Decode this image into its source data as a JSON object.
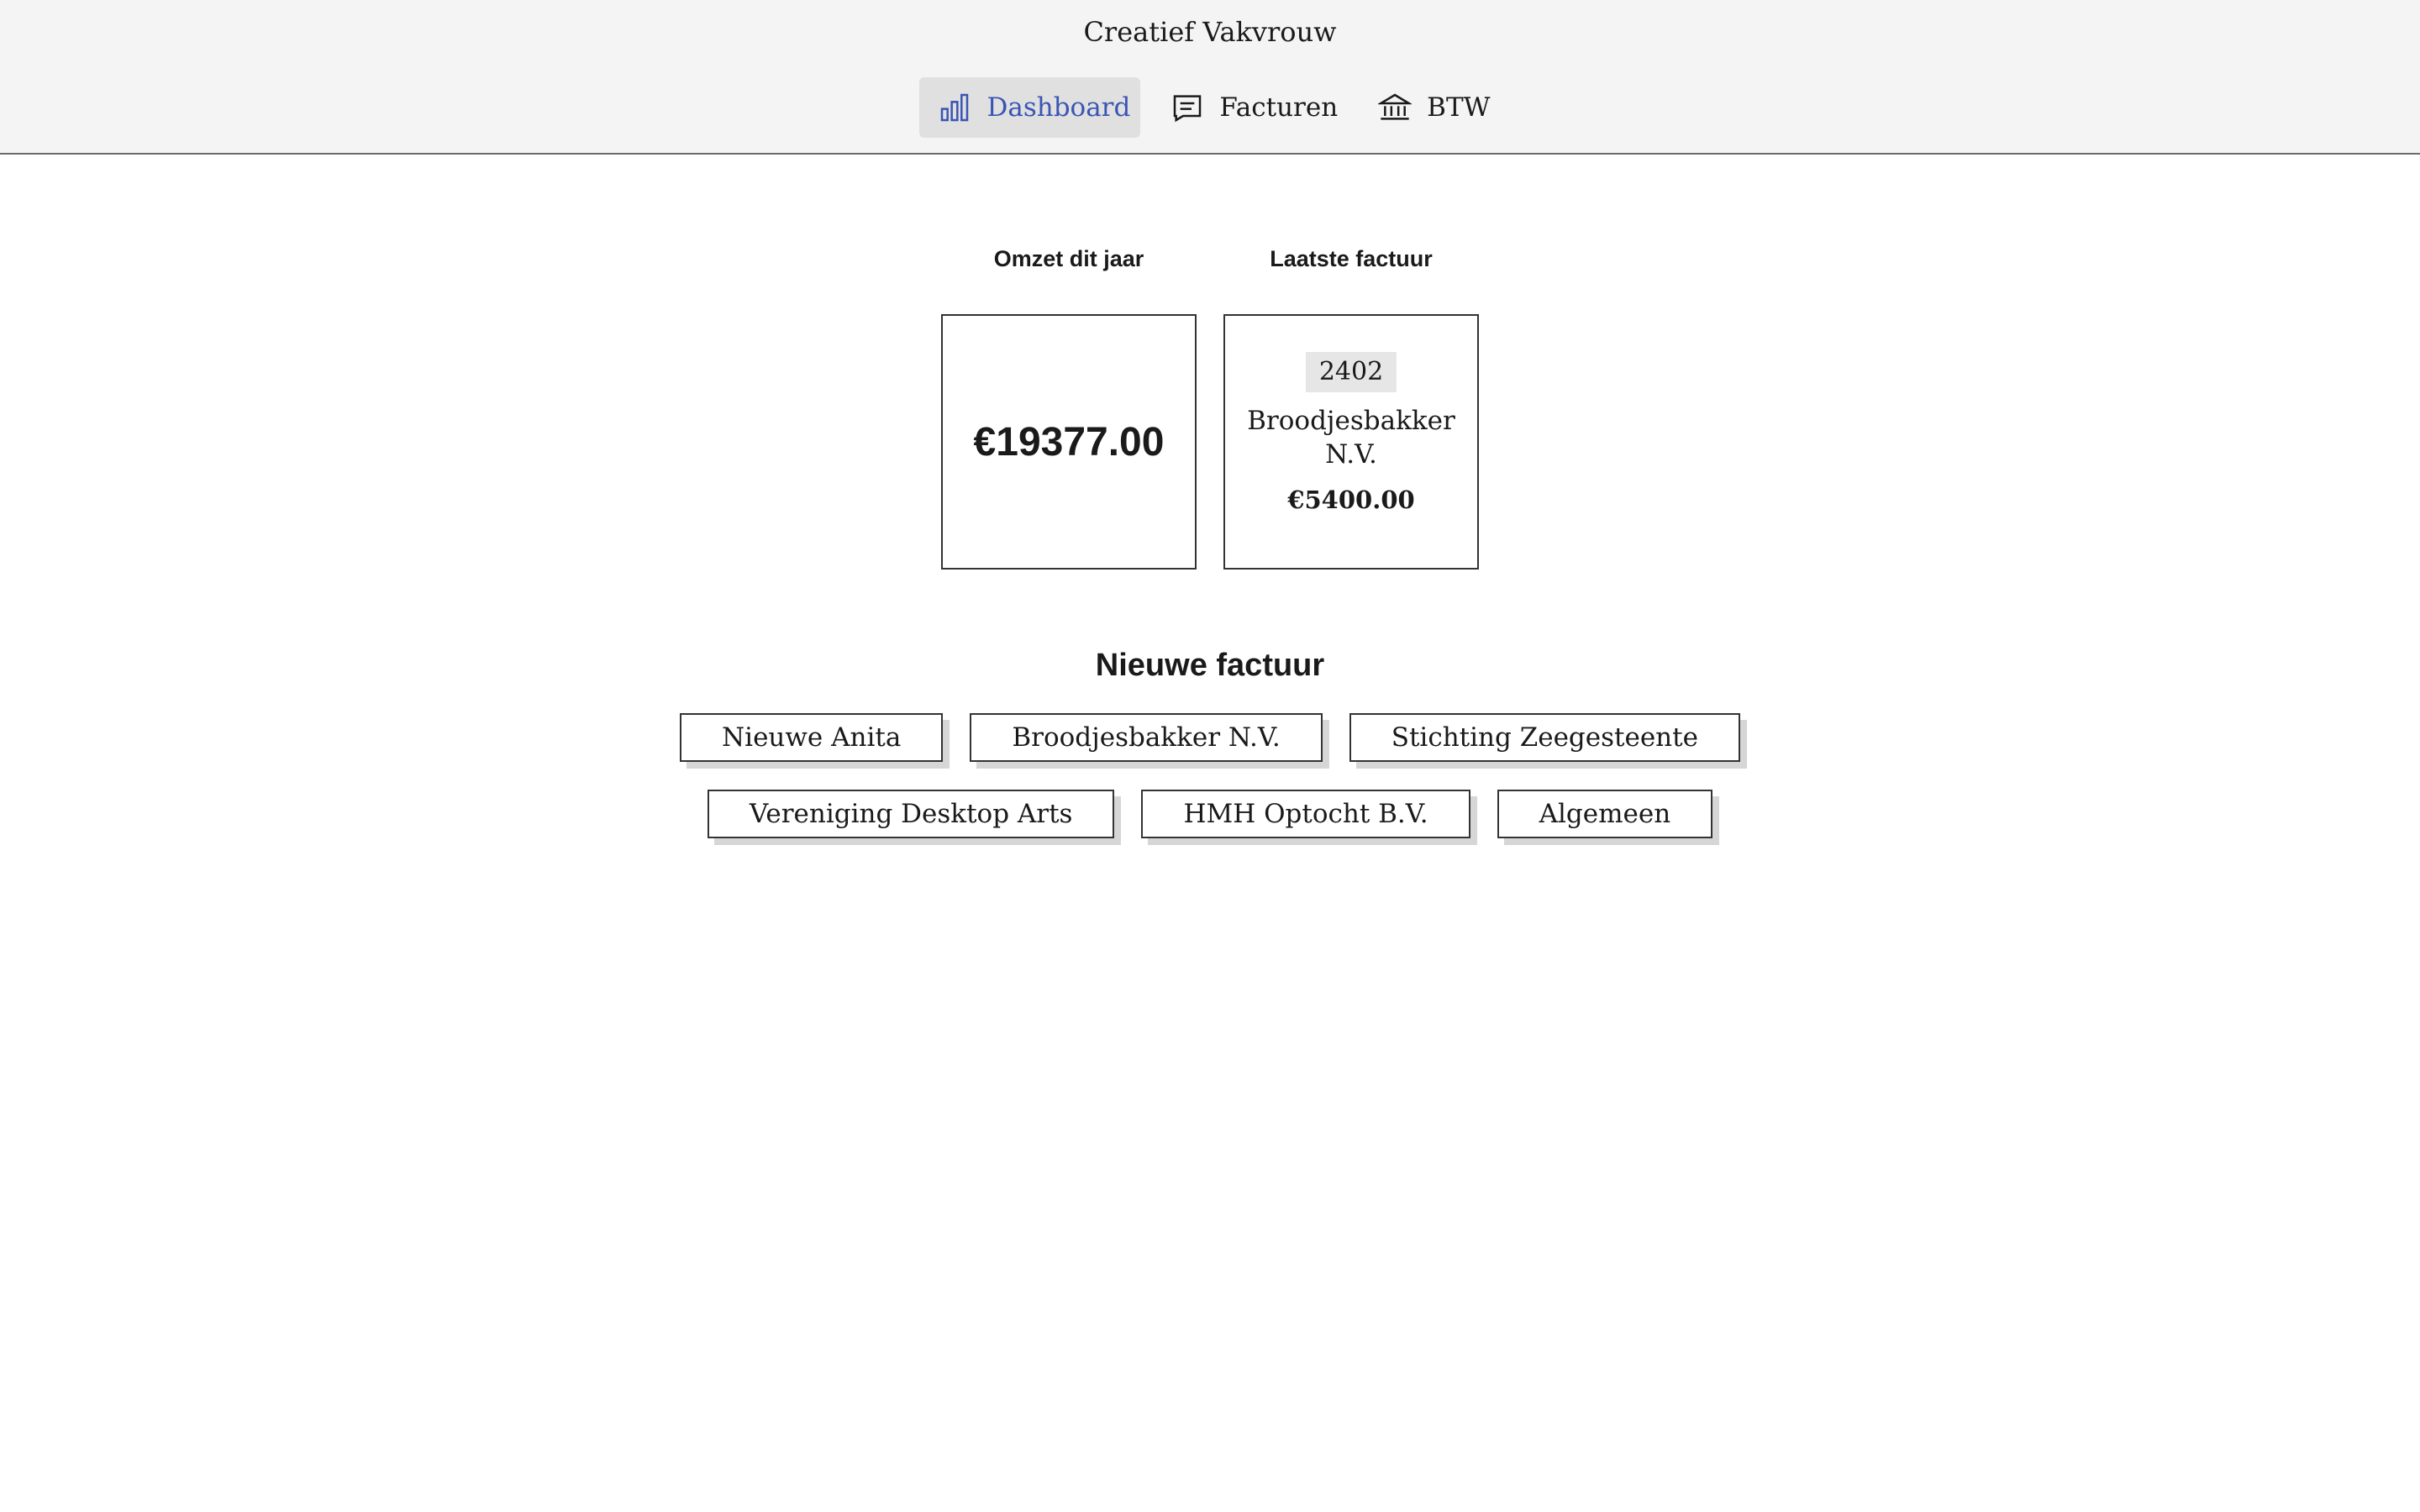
{
  "app": {
    "title": "Creatief Vakvrouw"
  },
  "nav": {
    "items": [
      {
        "label": "Dashboard",
        "icon": "bar-chart-icon",
        "active": true
      },
      {
        "label": "Facturen",
        "icon": "invoice-icon",
        "active": false
      },
      {
        "label": "BTW",
        "icon": "bank-icon",
        "active": false
      }
    ]
  },
  "stats": {
    "revenue": {
      "label": "Omzet dit jaar",
      "value": "€19377.00"
    },
    "last_invoice": {
      "label": "Laatste factuur",
      "number": "2402",
      "client": "Broodjesbakker N.V.",
      "amount": "€5400.00"
    }
  },
  "new_invoice": {
    "title": "Nieuwe factuur",
    "clients": [
      "Nieuwe Anita",
      "Broodjesbakker N.V.",
      "Stichting Zeegesteente",
      "Vereniging Desktop Arts",
      "HMH Optocht B.V.",
      "Algemeen"
    ]
  },
  "colors": {
    "accent": "#3a55b4",
    "header_bg": "#f4f4f4",
    "active_nav_bg": "#e0e0e0"
  }
}
